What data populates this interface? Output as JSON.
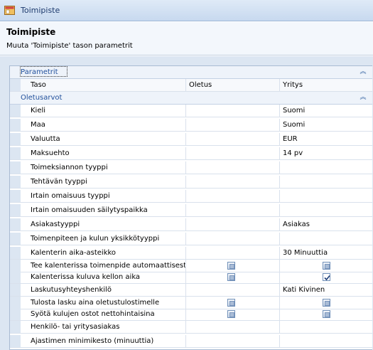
{
  "window": {
    "title": "Toimipiste"
  },
  "header": {
    "title": "Toimipiste",
    "subtitle": "Muuta 'Toimipiste' tason parametrit"
  },
  "sections": {
    "params": "Parametrit",
    "defaults": "Oletusarvot"
  },
  "columns": {
    "level": "Taso",
    "default": "Oletus",
    "company": "Yritys"
  },
  "rows": [
    {
      "label": "Kieli",
      "default": "",
      "company": "Suomi"
    },
    {
      "label": "Maa",
      "default": "",
      "company": "Suomi"
    },
    {
      "label": "Valuutta",
      "default": "",
      "company": "EUR"
    },
    {
      "label": "Maksuehto",
      "default": "",
      "company": "14 pv"
    },
    {
      "label": "Toimeksiannon tyyppi",
      "default": "",
      "company": ""
    },
    {
      "label": "Tehtävän tyyppi",
      "default": "",
      "company": ""
    },
    {
      "label": "Irtain omaisuus tyyppi",
      "default": "",
      "company": ""
    },
    {
      "label": "Irtain omaisuuden säilytyspaikka",
      "default": "",
      "company": ""
    },
    {
      "label": "Asiakastyyppi",
      "default": "",
      "company": "Asiakas"
    },
    {
      "label": "Toimenpiteen ja kulun yksikkötyyppi",
      "default": "",
      "company": ""
    },
    {
      "label": "Kalenterin aika-asteikko",
      "default": "",
      "company": "30 Minuuttia"
    },
    {
      "label": "Tee kalenterissa toimenpide automaattisesti",
      "default_check": "indeterminate",
      "company_check": "indeterminate"
    },
    {
      "label": "Kalenterissa kuluva kellon aika",
      "default_check": "indeterminate",
      "company_check": "checked"
    },
    {
      "label": "Laskutusyhteyshenkilö",
      "default": "",
      "company": "Kati Kivinen"
    },
    {
      "label": "Tulosta lasku aina oletustulostimelle",
      "default_check": "indeterminate",
      "company_check": "indeterminate"
    },
    {
      "label": "Syötä kulujen ostot nettohintaisina",
      "default_check": "indeterminate",
      "company_check": "indeterminate"
    },
    {
      "label": "Henkilö- tai yritysasiakas",
      "default": "",
      "company": ""
    },
    {
      "label": "Ajastimen minimikesto (minuuttia)",
      "default": "",
      "company": ""
    }
  ],
  "icons": {
    "app": "app-window-icon",
    "collapse": "double-chevron-up-icon",
    "checkbox": "checkbox-icon"
  }
}
